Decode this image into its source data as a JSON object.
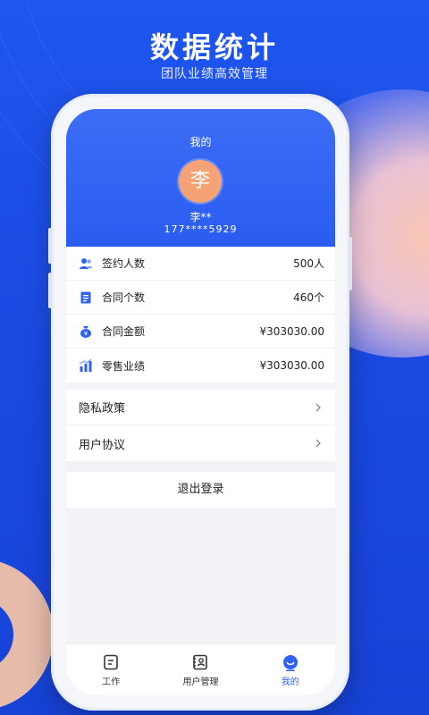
{
  "hero": {
    "title": "数据统计",
    "subtitle": "团队业绩高效管理"
  },
  "profile": {
    "header_title": "我的",
    "avatar_char": "李",
    "name": "李**",
    "phone": "177****5929"
  },
  "stats": [
    {
      "icon": "users-icon",
      "label": "签约人数",
      "value": "500人"
    },
    {
      "icon": "document-icon",
      "label": "合同个数",
      "value": "460个"
    },
    {
      "icon": "money-bag-icon",
      "label": "合同金额",
      "value": "¥303030.00"
    },
    {
      "icon": "bar-chart-icon",
      "label": "零售业绩",
      "value": "¥303030.00"
    }
  ],
  "menu": [
    {
      "label": "隐私政策"
    },
    {
      "label": "用户协议"
    }
  ],
  "logout_label": "退出登录",
  "tabs": [
    {
      "label": "工作",
      "icon": "work-icon"
    },
    {
      "label": "用户管理",
      "icon": "user-card-icon"
    },
    {
      "label": "我的",
      "icon": "me-icon",
      "active": true
    }
  ],
  "colors": {
    "primary": "#2f62f2",
    "avatar": "#f6a277",
    "background": "#1c4fe6"
  }
}
